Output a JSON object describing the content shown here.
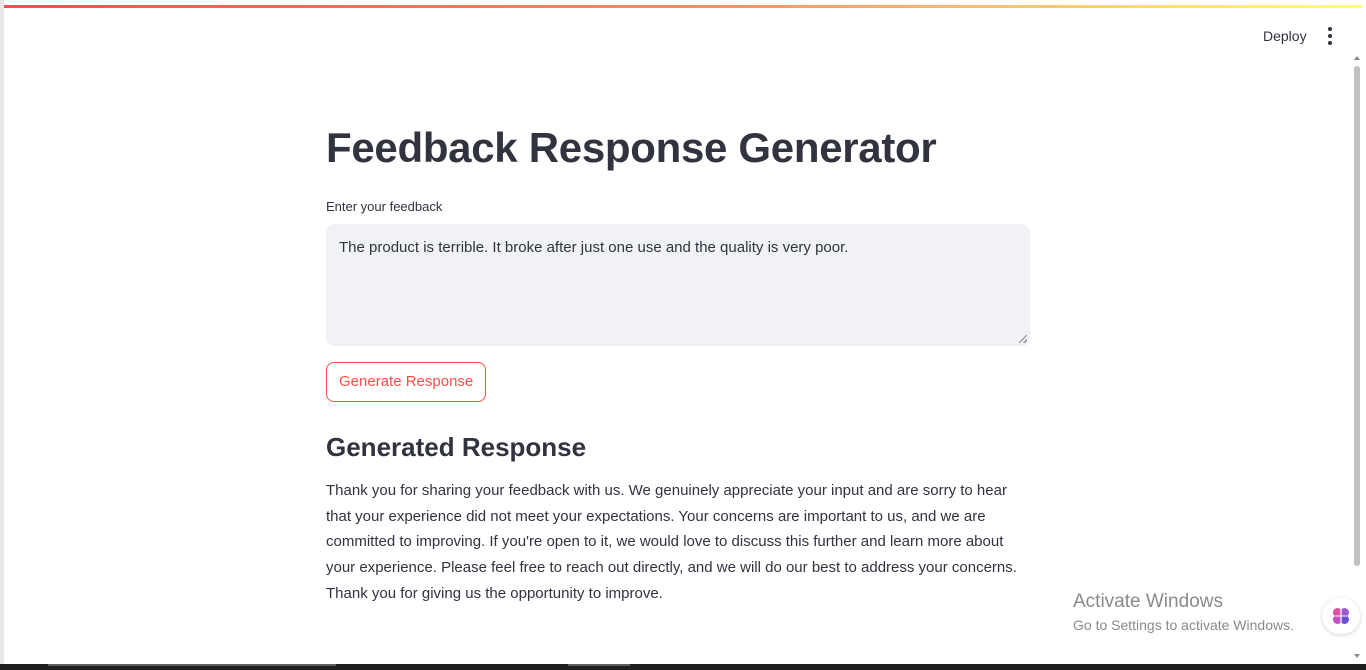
{
  "header": {
    "deploy_label": "Deploy",
    "menu_icon": "vertical-dots-icon"
  },
  "main": {
    "title": "Feedback Response Generator",
    "feedback_label": "Enter your feedback",
    "feedback_value": "The product is terrible. It broke after just one use and the quality is very poor.",
    "generate_button": "Generate Response",
    "response_heading": "Generated Response",
    "response_text": "Thank you for sharing your feedback with us. We genuinely appreciate your input and are sorry to hear that your experience did not meet your expectations. Your concerns are important to us, and we are committed to improving. If you're open to it, we would love to discuss this further and learn more about your experience. Please feel free to reach out directly, and we will do our best to address your concerns. Thank you for giving us the opportunity to improve."
  },
  "watermark": {
    "title": "Activate Windows",
    "subtitle": "Go to Settings to activate Windows."
  },
  "colors": {
    "accent": "#ff4b4b",
    "text": "#31333f",
    "input_bg": "#f0f2f6"
  },
  "icons": {
    "widget": "brain-icon"
  }
}
